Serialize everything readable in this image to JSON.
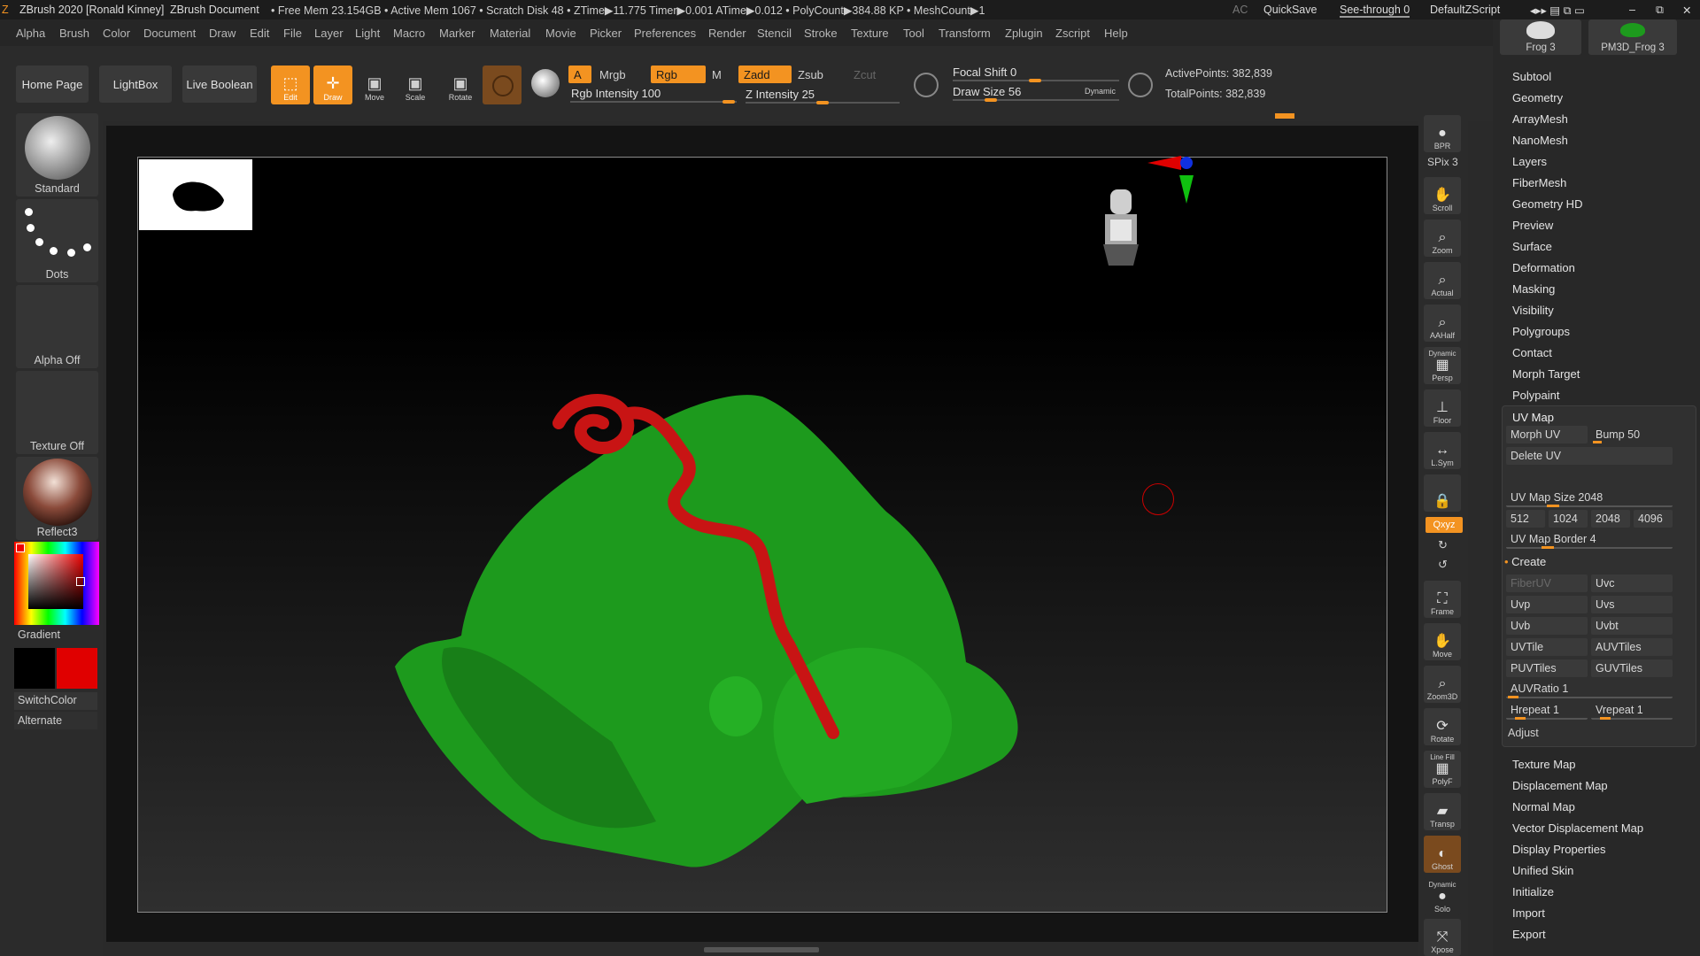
{
  "titlebar": {
    "app": "ZBrush 2020 [Ronald Kinney]",
    "doc": "ZBrush Document",
    "stats": "• Free Mem 23.154GB • Active Mem 1067 • Scratch Disk 48 • ZTime▶11.775 Timer▶0.001 ATime▶0.012 • PolyCount▶384.88 KP • MeshCount▶1",
    "ac": "AC",
    "quicksave": "QuickSave",
    "seethrough": "See-through 0",
    "script": "DefaultZScript"
  },
  "menu": [
    "Alpha",
    "Brush",
    "Color",
    "Document",
    "Draw",
    "Edit",
    "File",
    "Layer",
    "Light",
    "Macro",
    "Marker",
    "Material",
    "Movie",
    "Picker",
    "Preferences",
    "Render",
    "Stencil",
    "Stroke",
    "Texture",
    "Tool",
    "Transform",
    "Zplugin",
    "Zscript",
    "Help"
  ],
  "nav": {
    "home": "Home Page",
    "lightbox": "LightBox",
    "liveboolean": "Live Boolean"
  },
  "tools": {
    "edit": "Edit",
    "draw": "Draw",
    "move": "Move",
    "scale": "Scale",
    "rotate": "Rotate"
  },
  "modes": {
    "a": "A",
    "mrgb": "Mrgb",
    "rgb": "Rgb",
    "m": "M",
    "zadd": "Zadd",
    "zsub": "Zsub",
    "zcut": "Zcut"
  },
  "sliders": {
    "rgb_intensity": "Rgb Intensity 100",
    "z_intensity": "Z Intensity 25",
    "focal_shift": "Focal Shift 0",
    "draw_size": "Draw Size 56",
    "dynamic": "Dynamic",
    "rgb_intensity_value": 100,
    "z_intensity_value": 25,
    "focal_shift_value": 0,
    "draw_size_value": 56
  },
  "points": {
    "active": "ActivePoints: 382,839",
    "total": "TotalPoints: 382,839"
  },
  "left": {
    "brush": "Standard",
    "stroke": "Dots",
    "alpha": "Alpha Off",
    "texture": "Texture Off",
    "material": "Reflect3",
    "gradient": "Gradient",
    "switchcolor": "SwitchColor",
    "alternate": "Alternate"
  },
  "rightstrip": {
    "bpr": "BPR",
    "spix": "SPix 3",
    "scroll": "Scroll",
    "zoom": "Zoom",
    "actual": "Actual",
    "aahalf": "AAHalf",
    "dynamic": "Dynamic",
    "persp": "Persp",
    "floor": "Floor",
    "lsym": "L.Sym",
    "xyz": "Qxyz",
    "frame": "Frame",
    "move": "Move",
    "zoom3d": "Zoom3D",
    "rotate": "Rotate",
    "linefill": "Line Fill",
    "polyf": "PolyF",
    "transp": "Transp",
    "ghost": "Ghost",
    "dynamic2": "Dynamic",
    "solo": "Solo",
    "xpose": "Xpose"
  },
  "toolthumbs": {
    "frog1": "Frog 3",
    "frog2": "PM3D_Frog 3"
  },
  "panel": {
    "items_top": [
      "Subtool",
      "Geometry",
      "ArrayMesh",
      "NanoMesh",
      "Layers",
      "FiberMesh",
      "Geometry HD",
      "Preview",
      "Surface",
      "Deformation",
      "Masking",
      "Visibility",
      "Polygroups",
      "Contact",
      "Morph Target",
      "Polypaint"
    ],
    "uvmap": {
      "title": "UV Map",
      "morphuv": "Morph UV",
      "bump": "Bump 50",
      "deleteuv": "Delete UV",
      "size": "UV Map Size 2048",
      "sizes": [
        "512",
        "1024",
        "2048",
        "4096"
      ],
      "border": "UV Map Border 4",
      "create": "Create",
      "grid": [
        [
          "FiberUV",
          "Uvc"
        ],
        [
          "Uvp",
          "Uvs"
        ],
        [
          "Uvb",
          "Uvbt"
        ],
        [
          "UVTile",
          "AUVTiles"
        ],
        [
          "PUVTiles",
          "GUVTiles"
        ]
      ],
      "auvratio": "AUVRatio 1",
      "hrepeat": "Hrepeat 1",
      "vrepeat": "Vrepeat 1",
      "adjust": "Adjust"
    },
    "items_bottom": [
      "Texture Map",
      "Displacement Map",
      "Normal Map",
      "Vector Displacement Map",
      "Display Properties",
      "Unified Skin",
      "Initialize",
      "Import",
      "Export"
    ]
  },
  "colors": {
    "accent": "#f39321",
    "primary": "#000000",
    "secondary": "#e00000",
    "mesh": "#1d9a1d",
    "paint": "#c81414"
  }
}
